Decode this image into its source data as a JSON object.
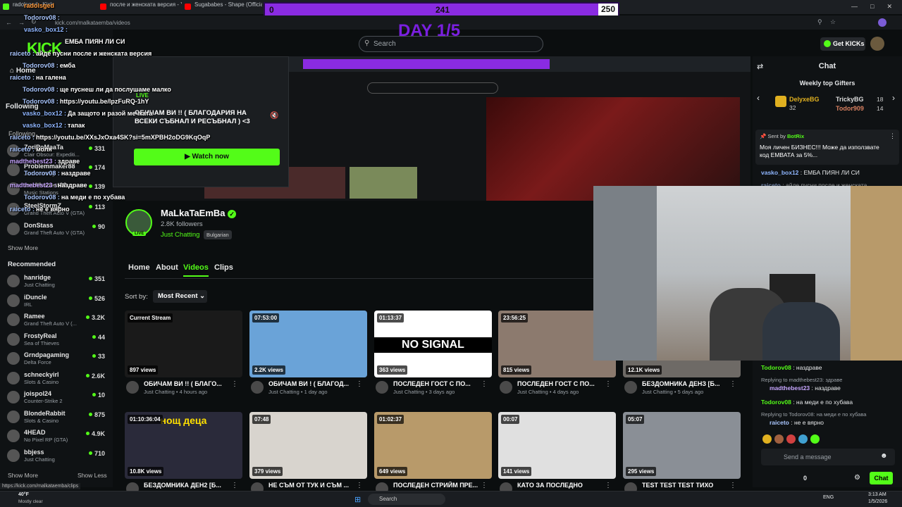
{
  "browser": {
    "tabs": [
      "radolsged - Kick",
      "после и женската версия - Yo",
      "Sugababes - Shape (Official Vi"
    ],
    "url": "kick.com/malkataemba/videos",
    "status_url": "https://kick.com/malkataemba/clips"
  },
  "overlay": {
    "progress": {
      "current": "0",
      "mid": "241",
      "goal": "250"
    },
    "day": "DAY 1/5"
  },
  "header": {
    "search_placeholder": "Search",
    "get_kicks": "Get KICKs"
  },
  "sidebar": {
    "nav": [
      {
        "label": "Home"
      },
      {
        "label": "Following"
      }
    ],
    "following_heading": "Following",
    "following": [
      {
        "name": "ZoriPoMaaTa",
        "game": "Clair Obscur: Expediti...",
        "viewers": "331"
      },
      {
        "name": "Problemmaker88",
        "game": "Just Chatting",
        "viewers": "174"
      },
      {
        "name": "madthebest23",
        "game": "Music Stations",
        "viewers": "139"
      },
      {
        "name": "SteelStormZ",
        "game": "Grand Theft Auto V (GTA)",
        "viewers": "113"
      },
      {
        "name": "DonStass",
        "game": "Grand Theft Auto V (GTA)",
        "viewers": "90"
      }
    ],
    "show_more": "Show More",
    "recommended_heading": "Recommended",
    "recommended": [
      {
        "name": "hanridge",
        "game": "Just Chatting",
        "viewers": "351"
      },
      {
        "name": "iDuncle",
        "game": "IRL",
        "viewers": "526"
      },
      {
        "name": "Ramee",
        "game": "Grand Theft Auto V (...",
        "viewers": "3.2K"
      },
      {
        "name": "FrostyReal",
        "game": "Sea of Thieves",
        "viewers": "44"
      },
      {
        "name": "Grndpagaming",
        "game": "Delta Force",
        "viewers": "33"
      },
      {
        "name": "schneckyirl",
        "game": "Slots & Casino",
        "viewers": "2.6K"
      },
      {
        "name": "joispol24",
        "game": "Counter-Strike 2",
        "viewers": "10"
      },
      {
        "name": "BlondeRabbit",
        "game": "Slots & Casino",
        "viewers": "875"
      },
      {
        "name": "4HEAD",
        "game": "No Pixel RP (GTA)",
        "viewers": "4.9K"
      },
      {
        "name": "bbjess",
        "game": "Just Chatting",
        "viewers": "710"
      }
    ],
    "show_more_2": "Show More",
    "show_less": "Show Less"
  },
  "chat_overlay": [
    {
      "user": "radolsged",
      "text": ""
    },
    {
      "user": "Todorov08 :",
      "text": ""
    },
    {
      "user": "vasko_box12 :",
      "text": ""
    },
    {
      "user": "",
      "text": "ЕМБА ПИЯН ЛИ СИ"
    },
    {
      "user": "raiceto :",
      "text": "айде пусни после и женската версия"
    },
    {
      "user": "Todorov08 :",
      "text": "емба"
    },
    {
      "user": "raiceto :",
      "text": "на галена"
    },
    {
      "user": "Todorov08 :",
      "text": "ще пуснеш ли да послушаме малко"
    },
    {
      "user": "Todorov08 :",
      "text": "https://youtu.be/lpzFuRQ-1hY"
    },
    {
      "user": "vasko_box12 :",
      "text": "Да защото и разой мечката"
    },
    {
      "user": "vasko_box12 :",
      "text": "тапак"
    },
    {
      "user": "raiceto :",
      "text": "https://youtu.be/XXsJxOxa4SK?si=5mXPBH2oDG9KqOqP"
    },
    {
      "user": "raiceto :",
      "text": "моля"
    },
    {
      "user": "madthebest23 :",
      "text": "здраве"
    },
    {
      "user": "Todorov08 :",
      "text": "наздраве"
    },
    {
      "user": "madthebest23 :",
      "text": "наздраве"
    },
    {
      "user": "Todorov08 :",
      "text": "на меди е по хубава"
    },
    {
      "user": "raiceto :",
      "text": "не е вярно"
    }
  ],
  "popup": {
    "live": "LIVE",
    "title": "ОБИЧАМ ВИ !! ( БЛАГОДАРИЯ НА ВСЕКИ СЪБНАЛ И РЕСЪБНАЛ ) <3",
    "watch_now": "Watch now"
  },
  "channel": {
    "name": "MaLkaTaEmBa",
    "followers": "2.8K followers",
    "category": "Just Chatting",
    "language": "Bulgarian",
    "live_badge": "LIVE",
    "tabs": [
      "Home",
      "About",
      "Videos",
      "Clips"
    ],
    "sort_label": "Sort by:",
    "sort_value": "Most Recent"
  },
  "videos": [
    {
      "badge": "Current Stream",
      "views": "897 views",
      "title": "ОБИЧАМ ВИ !! ( БЛАГО...",
      "sub": "Just Chatting • 4 hours ago",
      "color": "#1a1a1a"
    },
    {
      "badge": "07:53:00",
      "views": "2.2K views",
      "title": "ОБИЧАМ ВИ ! ( БЛАГОД...",
      "sub": "Just Chatting • 1 day ago",
      "color": "#6aa3d8"
    },
    {
      "badge": "01:13:37",
      "views": "363 views",
      "title": "ПОСЛЕДЕН ГОСТ С ПО...",
      "sub": "Just Chatting • 3 days ago",
      "color": "#ffffff",
      "overlay_text": "NO SIGNAL"
    },
    {
      "badge": "23:56:25",
      "views": "815 views",
      "title": "ПОСЛЕДЕН ГОСТ С ПО...",
      "sub": "Just Chatting • 4 days ago",
      "color": "#8c7a6e"
    },
    {
      "badge": "",
      "views": "12.1K views",
      "title": "БЕЗДОМНИКА ДЕНЗ [Б...",
      "sub": "Just Chatting • 5 days ago",
      "color": "#6e6a66"
    },
    {
      "badge": "01:10:36:04",
      "views": "10.8K views",
      "title": "БЕЗДОМНИКА ДЕН2 [Б...",
      "sub": "",
      "color": "#2a2a3a",
      "overlay_text": "нощ деца"
    },
    {
      "badge": "07:48",
      "views": "379 views",
      "title": "НЕ СЪМ ОТ ТУК И СЪМ ...",
      "sub": "",
      "color": "#d8d4ce"
    },
    {
      "badge": "01:02:37",
      "views": "649 views",
      "title": "ПОСЛЕДЕН СТРИЙМ ПРЕ...",
      "sub": "",
      "color": "#b89a6a"
    },
    {
      "badge": "00:07",
      "views": "141 views",
      "title": "КАТО ЗА ПОСЛЕДНО",
      "sub": "",
      "color": "#e0e0e0"
    },
    {
      "badge": "05:07",
      "views": "295 views",
      "title": "TEST TEST TEST ТИХО",
      "sub": "",
      "color": "#8a8f96"
    }
  ],
  "chat": {
    "title": "Chat",
    "weekly_gifters": "Weekly top Gifters",
    "gifters": [
      {
        "name": "DelyxeBG",
        "count": "32"
      },
      {
        "name": "TrickyBG",
        "count": "18"
      },
      {
        "name": "Todor909",
        "count": "14"
      }
    ],
    "pinned_sent_by": "Sent by",
    "pinned_user": "BotRix",
    "pinned_text": "Моя личен БИЗНЕС!!! Може да използвате код ЕМВАТА за 5%...",
    "messages": [
      {
        "user": "vasko_box12",
        "text": "ЕМБА ПИЯН ЛИ СИ"
      },
      {
        "user": "raiceto",
        "text": "айде пусни после и женската"
      },
      {
        "user": "Todorov08",
        "text": "наздраве"
      },
      {
        "user": "Replying to madthebest23:",
        "text": "здраве"
      },
      {
        "user": "madthebest23",
        "text": "наздраве"
      },
      {
        "user": "Todorov08",
        "text": "на меди е по хубава"
      },
      {
        "user": "Replying to Todorov08:",
        "text": "на меди е по хубава"
      },
      {
        "user": "raiceto",
        "text": "не е вярно"
      }
    ],
    "send_placeholder": "Send a message",
    "kicks_count": "0",
    "chat_button": "Chat"
  },
  "taskbar": {
    "weather_temp": "40°F",
    "weather_desc": "Mostly clear",
    "search": "Search",
    "lang": "ENG",
    "time": "3:13 AM",
    "date": "1/5/2026"
  }
}
